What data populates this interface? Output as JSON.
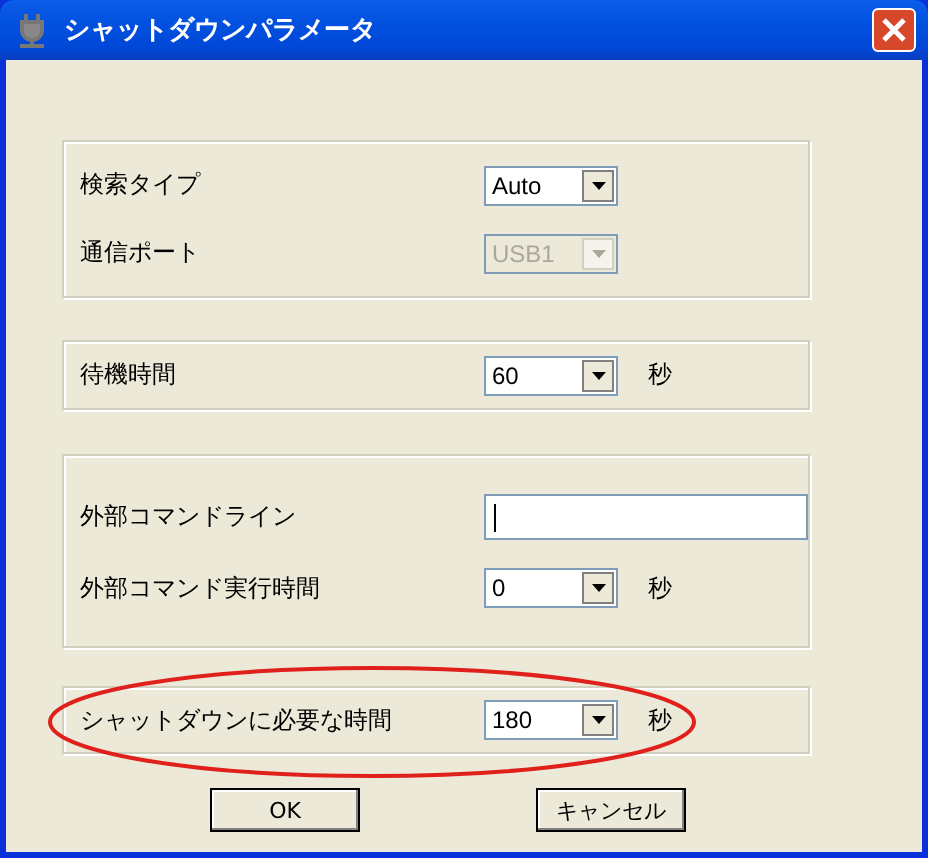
{
  "window": {
    "title": "シャットダウンパラメータ"
  },
  "groups": [
    {
      "highlighted": false,
      "fields": [
        {
          "kind": "combo",
          "label": "検索タイプ",
          "value": "Auto",
          "disabled": false
        },
        {
          "kind": "combo",
          "label": "通信ポート",
          "value": "USB1",
          "disabled": true
        }
      ]
    },
    {
      "highlighted": false,
      "fields": [
        {
          "kind": "combo",
          "label": "待機時間",
          "value": "60",
          "disabled": false,
          "unit": "秒"
        }
      ]
    },
    {
      "highlighted": false,
      "fields": [
        {
          "kind": "text",
          "label": "外部コマンドライン",
          "focused": true
        },
        {
          "kind": "combo",
          "label": "外部コマンド実行時間",
          "value": "0",
          "disabled": false,
          "unit": "秒"
        }
      ]
    },
    {
      "highlighted": true,
      "fields": [
        {
          "kind": "combo",
          "label": "シャットダウンに必要な時間",
          "value": "180",
          "disabled": false,
          "unit": "秒"
        }
      ]
    }
  ],
  "buttons": [
    "OK",
    "キャンセル"
  ]
}
